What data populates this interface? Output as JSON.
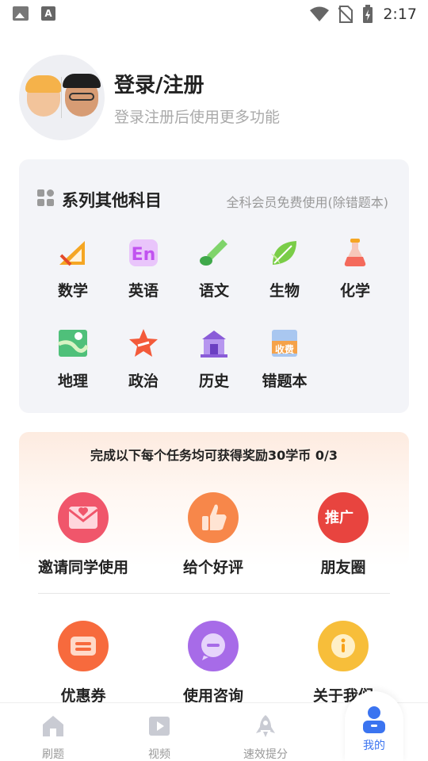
{
  "status_bar": {
    "time": "2:17",
    "left_icons": [
      "image-icon",
      "font-a-icon"
    ],
    "right_icons": [
      "wifi-icon",
      "no-sim-icon",
      "battery-charging-icon"
    ]
  },
  "profile": {
    "title": "登录/注册",
    "subtitle": "登录注册后使用更多功能"
  },
  "subjects": {
    "title": "系列其他科目",
    "note": "全科会员免费使用(除错题本)",
    "items": [
      {
        "label": "数学",
        "icon": "ruler-icon",
        "color": "#f5a623"
      },
      {
        "label": "英语",
        "icon": "en-icon",
        "color": "#c152f0"
      },
      {
        "label": "语文",
        "icon": "brush-icon",
        "color": "#5cc15a"
      },
      {
        "label": "生物",
        "icon": "leaf-icon",
        "color": "#7acd48"
      },
      {
        "label": "化学",
        "icon": "flask-icon",
        "color": "#f46a5c"
      },
      {
        "label": "地理",
        "icon": "map-icon",
        "color": "#4fc07a"
      },
      {
        "label": "政治",
        "icon": "star-icon",
        "color": "#f35a3a"
      },
      {
        "label": "历史",
        "icon": "building-icon",
        "color": "#8a5cd8"
      },
      {
        "label": "错题本",
        "icon": "fee-book-icon",
        "color": "#f5a24a",
        "badge": "收费"
      }
    ]
  },
  "tasks": {
    "title": "完成以下每个任务均可获得奖励30学币 0/3",
    "items": [
      {
        "label": "邀请同学使用",
        "icon": "invite-envelope-icon",
        "color": "#f0566b"
      },
      {
        "label": "给个好评",
        "icon": "thumbs-up-icon",
        "color": "#f7874a"
      },
      {
        "label": "朋友圈",
        "icon": "promote-icon",
        "color": "#e8443f",
        "badge": "推广"
      }
    ],
    "more": [
      {
        "label": "优惠券",
        "icon": "coupon-icon",
        "color": "#f76a3d"
      },
      {
        "label": "使用咨询",
        "icon": "chat-icon",
        "color": "#a76be8"
      },
      {
        "label": "关于我们",
        "icon": "info-icon",
        "color": "#f7be3a"
      }
    ]
  },
  "nav": {
    "items": [
      {
        "label": "刷题",
        "icon": "home-icon"
      },
      {
        "label": "视频",
        "icon": "video-icon"
      },
      {
        "label": "速效提分",
        "icon": "rocket-icon"
      },
      {
        "label": "我的",
        "icon": "user-icon",
        "active": true
      }
    ],
    "active_color": "#3b74f0",
    "inactive_color": "#999999"
  }
}
